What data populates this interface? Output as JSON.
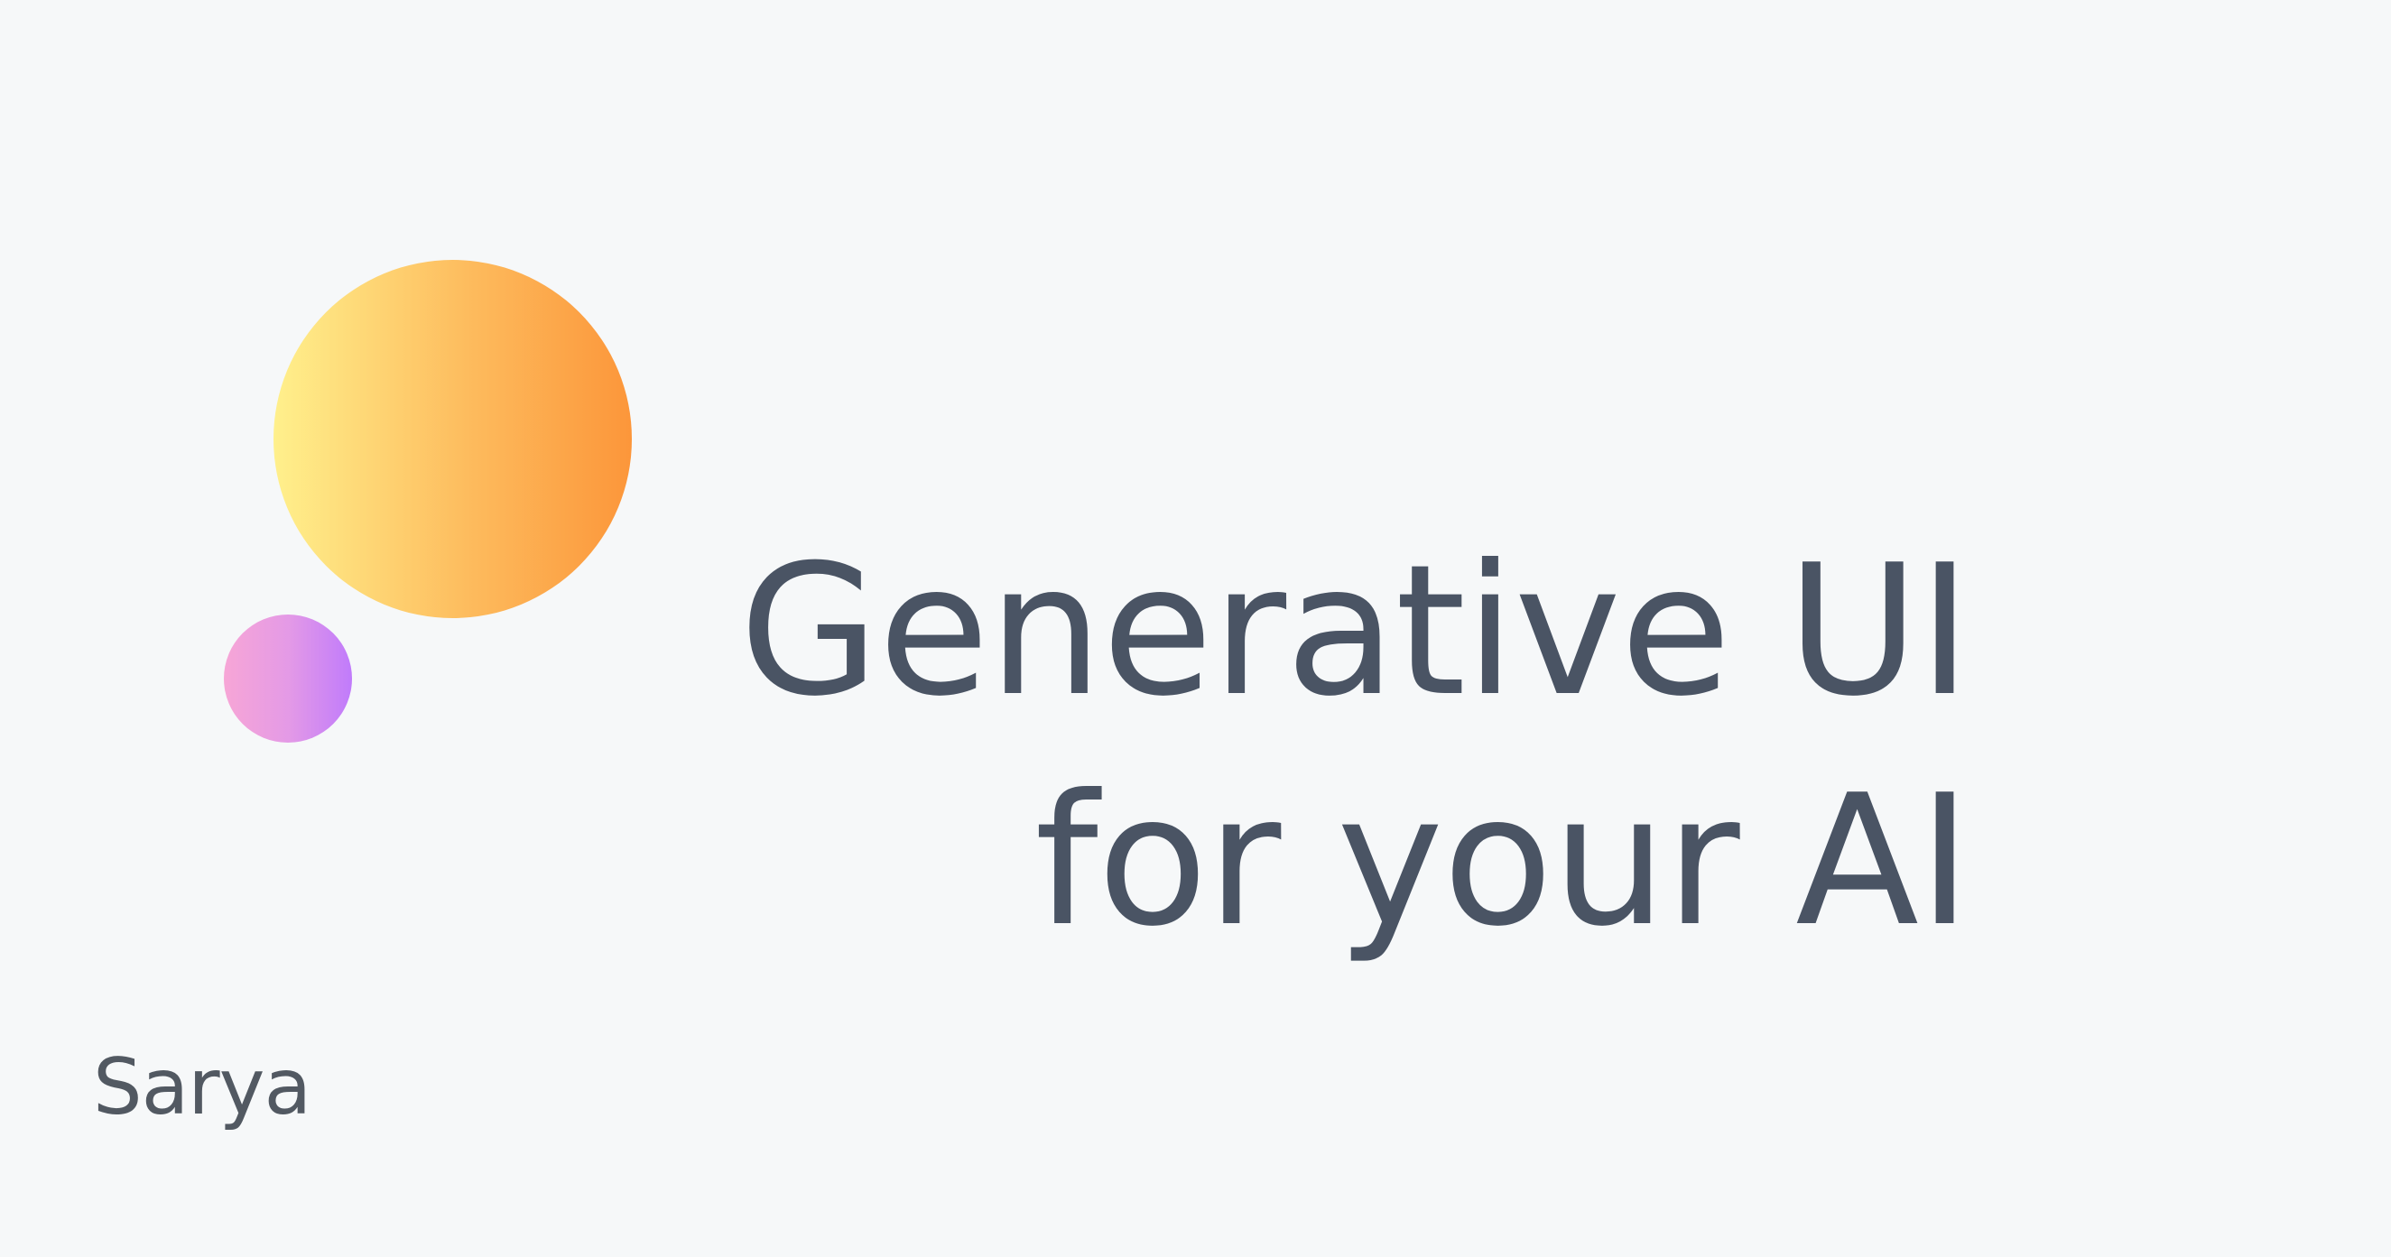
{
  "headline": {
    "line1": "Generative UI",
    "line2": "for your AI"
  },
  "brand": {
    "name": "Sarya"
  },
  "colors": {
    "background": "#f6f8f9",
    "text": "#4a5464",
    "brand_text": "#525962",
    "orb_large_gradient": [
      "#fff08c",
      "#fdbb5d",
      "#fc963a"
    ],
    "orb_small_gradient": [
      "#f7a6d6",
      "#e49ae6",
      "#c07bfb"
    ]
  }
}
